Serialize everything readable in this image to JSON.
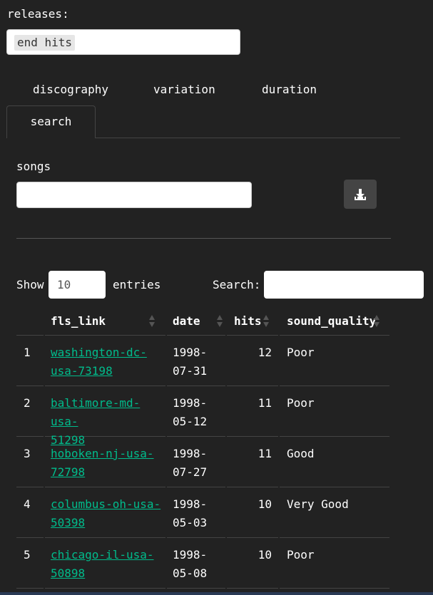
{
  "releases": {
    "label": "releases:",
    "selected": "end hits"
  },
  "tabs": {
    "items": [
      "discography",
      "variation",
      "duration"
    ],
    "active": "search"
  },
  "songs": {
    "label": "songs",
    "value": ""
  },
  "download": {
    "icon": "download-icon"
  },
  "datatable": {
    "show_label": "Show",
    "entries_value": "10",
    "entries_label": "entries",
    "search_label": "Search:",
    "search_value": "",
    "columns": [
      "fls_link",
      "date",
      "hits",
      "sound_quality"
    ],
    "rows": [
      {
        "idx": "1",
        "link": [
          "washington-dc-",
          "usa-73198"
        ],
        "date": [
          "1998-",
          "07-31"
        ],
        "hits": "12",
        "quality": "Poor"
      },
      {
        "idx": "2",
        "link": [
          "baltimore-md-usa-",
          "51298"
        ],
        "date": [
          "1998-",
          "05-12"
        ],
        "hits": "11",
        "quality": "Poor"
      },
      {
        "idx": "3",
        "link": [
          "hoboken-nj-usa-",
          "72798"
        ],
        "date": [
          "1998-",
          "07-27"
        ],
        "hits": "11",
        "quality": "Good"
      },
      {
        "idx": "4",
        "link": [
          "columbus-oh-usa-",
          "50398"
        ],
        "date": [
          "1998-",
          "05-03"
        ],
        "hits": "10",
        "quality": "Very Good"
      },
      {
        "idx": "5",
        "link": [
          "chicago-il-usa-",
          "50898"
        ],
        "date": [
          "1998-",
          "05-08"
        ],
        "hits": "10",
        "quality": "Poor"
      }
    ]
  },
  "colors": {
    "background": "#222222",
    "link": "#00bc8c",
    "button": "#444444"
  }
}
